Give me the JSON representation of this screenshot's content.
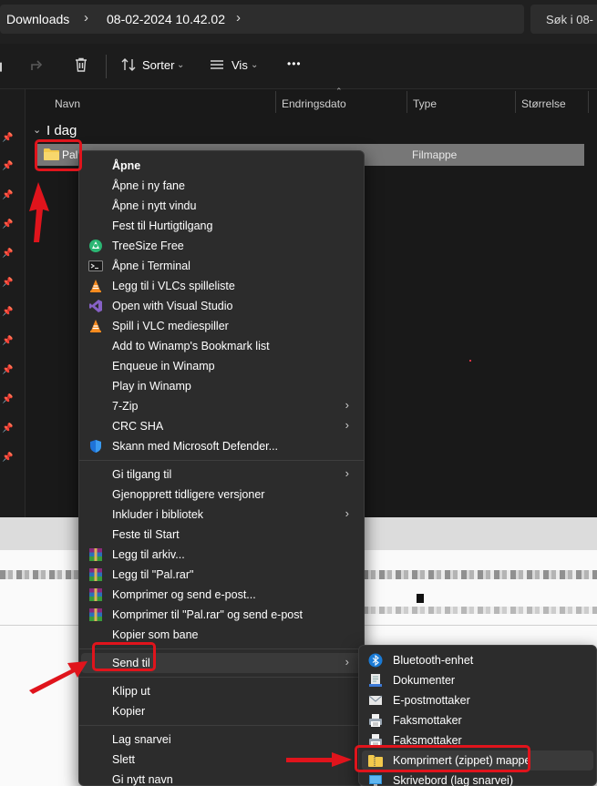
{
  "address": {
    "crumbs": [
      "Downloads",
      "08-02-2024 10.42.02"
    ],
    "search_placeholder": "Søk i 08-"
  },
  "toolbar": {
    "sort_label": "Sorter",
    "view_label": "Vis",
    "more_label": "•••"
  },
  "columns": [
    "Navn",
    "Endringsdato",
    "Type",
    "Størrelse"
  ],
  "group_label": "I dag",
  "file": {
    "name": "Pal",
    "type": "Filmappe"
  },
  "context_menu": {
    "items": [
      {
        "label": "Åpne",
        "bold": true,
        "icon": ""
      },
      {
        "label": "Åpne i ny fane",
        "icon": ""
      },
      {
        "label": "Åpne i nytt vindu",
        "icon": ""
      },
      {
        "label": "Fest til Hurtigtilgang",
        "icon": ""
      },
      {
        "label": "TreeSize Free",
        "icon": "treesize-icon"
      },
      {
        "label": "Åpne i Terminal",
        "icon": "terminal-icon"
      },
      {
        "label": "Legg til i VLCs spilleliste",
        "icon": "vlc-icon"
      },
      {
        "label": "Open with Visual Studio",
        "icon": "visual-studio-icon"
      },
      {
        "label": "Spill i VLC mediespiller",
        "icon": "vlc-icon"
      },
      {
        "label": "Add to Winamp's Bookmark list",
        "icon": ""
      },
      {
        "label": "Enqueue in Winamp",
        "icon": ""
      },
      {
        "label": "Play in Winamp",
        "icon": ""
      },
      {
        "label": "7-Zip",
        "icon": "",
        "submenu": true
      },
      {
        "label": "CRC SHA",
        "icon": "",
        "submenu": true
      },
      {
        "label": "Skann med Microsoft Defender...",
        "icon": "defender-shield-icon"
      },
      {
        "label": "Gi tilgang til",
        "icon": "",
        "submenu": true,
        "separator_before": true
      },
      {
        "label": "Gjenopprett tidligere versjoner",
        "icon": ""
      },
      {
        "label": "Inkluder i bibliotek",
        "icon": "",
        "submenu": true
      },
      {
        "label": "Feste til Start",
        "icon": ""
      },
      {
        "label": "Legg til arkiv...",
        "icon": "winrar-icon"
      },
      {
        "label": "Legg til \"Pal.rar\"",
        "icon": "winrar-icon"
      },
      {
        "label": "Komprimer og send e-post...",
        "icon": "winrar-icon"
      },
      {
        "label": "Komprimer til \"Pal.rar\" og send e-post",
        "icon": "winrar-icon"
      },
      {
        "label": "Kopier som bane",
        "icon": ""
      },
      {
        "label": "Send til",
        "icon": "",
        "submenu": true,
        "separator_before": true,
        "selected": true
      },
      {
        "label": "Klipp ut",
        "icon": "",
        "separator_before": true
      },
      {
        "label": "Kopier",
        "icon": ""
      },
      {
        "label": "Lag snarvei",
        "icon": "",
        "separator_before": true
      },
      {
        "label": "Slett",
        "icon": ""
      },
      {
        "label": "Gi nytt navn",
        "icon": ""
      }
    ]
  },
  "send_to_menu": {
    "items": [
      {
        "label": "Bluetooth-enhet",
        "icon": "bluetooth-icon"
      },
      {
        "label": "Dokumenter",
        "icon": "documents-icon"
      },
      {
        "label": "E-postmottaker",
        "icon": "mail-recipient-icon"
      },
      {
        "label": "Faksmottaker",
        "icon": "fax-icon"
      },
      {
        "label": "Faksmottaker",
        "icon": "fax-icon"
      },
      {
        "label": "Komprimert (zippet) mappe",
        "icon": "zip-folder-icon",
        "selected": true
      },
      {
        "label": "Skrivebord (lag snarvei)",
        "icon": "desktop-icon"
      }
    ]
  },
  "colors": {
    "annotation": "#e0141c",
    "menu_bg": "#2c2c2c",
    "accent_blue": "#3b8fe8",
    "folder_yellow": "#f2c94c"
  }
}
